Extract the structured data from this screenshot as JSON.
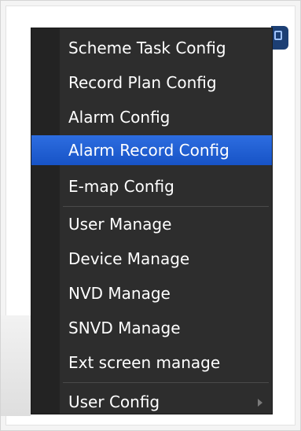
{
  "menu": {
    "items": [
      {
        "label": "Scheme Task Config"
      },
      {
        "label": "Record Plan Config"
      },
      {
        "label": "Alarm Config"
      },
      {
        "label": "Alarm Record Config",
        "selected": true
      },
      {
        "label": "E-map Config"
      },
      {
        "label": "User Manage"
      },
      {
        "label": "Device Manage"
      },
      {
        "label": "NVD Manage"
      },
      {
        "label": "SNVD Manage"
      },
      {
        "label": "Ext screen manage"
      },
      {
        "label": "User Config",
        "has_submenu": true
      }
    ]
  },
  "colors": {
    "menu_background": "#2d2d2d",
    "selected_highlight": "#1f5fd6",
    "text": "#ffffff"
  },
  "icons": {
    "submenu": "chevron-right-icon",
    "app_corner": "window-icon"
  }
}
